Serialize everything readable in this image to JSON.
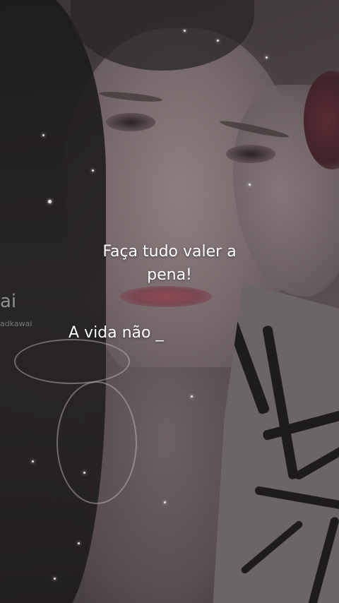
{
  "caption": {
    "main": "Faça tudo valer a pena!",
    "typing": "A vida não _"
  },
  "watermark": {
    "logo_fragment": "ai",
    "handle_fragment": "adkawai"
  }
}
